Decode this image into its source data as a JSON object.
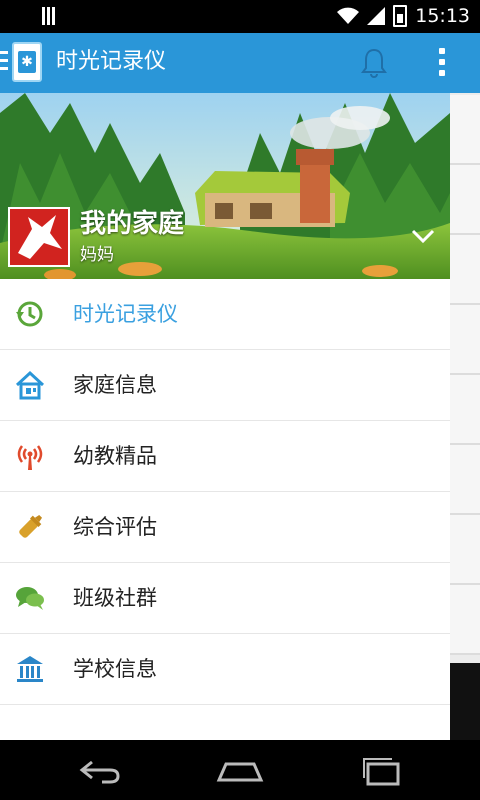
{
  "status_bar": {
    "time": "15:13"
  },
  "app_bar": {
    "title": "时光记录仪"
  },
  "drawer": {
    "header": {
      "family_name": "我的家庭",
      "role": "妈妈"
    },
    "menu": [
      {
        "label": "时光记录仪",
        "icon": "clock-history-icon",
        "active": true
      },
      {
        "label": "家庭信息",
        "icon": "home-icon",
        "active": false
      },
      {
        "label": "幼教精品",
        "icon": "broadcast-icon",
        "active": false
      },
      {
        "label": "综合评估",
        "icon": "baby-bottle-icon",
        "active": false
      },
      {
        "label": "班级社群",
        "icon": "chat-bubbles-icon",
        "active": false
      },
      {
        "label": "学校信息",
        "icon": "school-building-icon",
        "active": false
      }
    ]
  },
  "colors": {
    "app_bar": "#2a96d8",
    "active_text": "#3aa0e0",
    "clock_icon": "#5aa63a",
    "home_icon": "#2a96d8",
    "broadcast_icon": "#e04a2c",
    "bottle_icon": "#d9a12b",
    "chat_icon": "#56a43a",
    "school_icon": "#2a86c8"
  }
}
